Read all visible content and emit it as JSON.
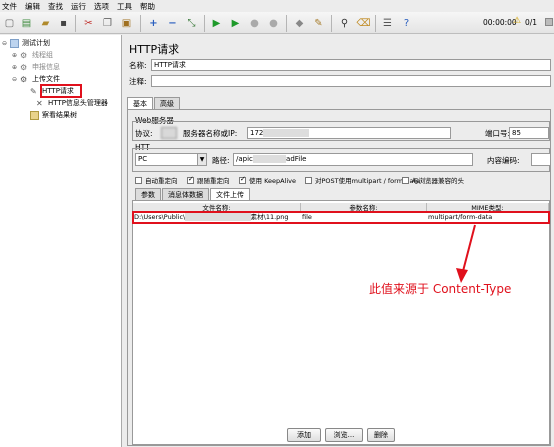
{
  "menu": [
    "文件",
    "编辑",
    "查找",
    "运行",
    "选项",
    "工具",
    "帮助"
  ],
  "status": {
    "time": "00:00:00",
    "warnings": "3",
    "errors": "0/1"
  },
  "tree": {
    "test_plan": "测试计划",
    "thread_group": "线程组",
    "report_info": "申报信息",
    "upload_file": "上传文件",
    "http_request": "HTTP请求",
    "header_manager": "HTTP信息头管理器",
    "result_tree": "察看结果树"
  },
  "main": {
    "title": "HTTP请求",
    "name_label": "名称:",
    "name_value": "HTTP请求",
    "comment_label": "注释:",
    "tabs": [
      "基本",
      "高级"
    ],
    "web_server": "Web服务器",
    "protocol_label": "协议:",
    "server_label": "服务器名称或IP:",
    "server_value": "172",
    "port_label": "端口号:",
    "port_value": "85",
    "http_label": "HTT",
    "method_value": "PC",
    "path_label": "路径:",
    "path_value": "/apic",
    "path_value_tail": "adFile",
    "encoding_label": "内容编码:",
    "checkboxes": [
      "自动重定向",
      "跟随重定向",
      "使用 KeepAlive",
      "对POST使用multipart / form-data",
      "与浏览器兼容的头"
    ],
    "subtabs": [
      "参数",
      "消息体数据",
      "文件上传"
    ],
    "columns": [
      "文件名称:",
      "参数名称:",
      "MIME类型:"
    ],
    "row": {
      "file": "D:\\Users\\Public\\",
      "file_tail": "素材\\11.png",
      "param": "file",
      "mime": "multipart/form-data"
    },
    "buttons": {
      "add": "添加",
      "browse": "浏览...",
      "delete": "删除"
    }
  },
  "annotation": "此值来源于 Content-Type",
  "colors": {
    "annotation": "#e0101c"
  }
}
